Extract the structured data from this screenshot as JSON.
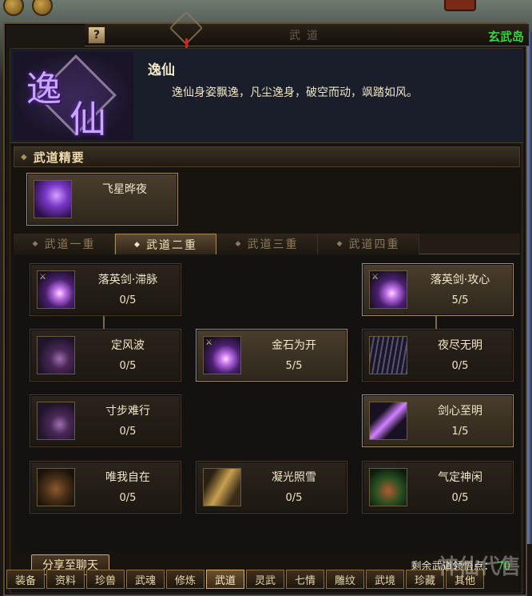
{
  "window": {
    "title": "武道",
    "region": "玄武岛",
    "help_label": "?"
  },
  "header": {
    "emblem_char_1": "逸",
    "emblem_char_2": "仙",
    "class_name": "逸仙",
    "class_desc": "逸仙身姿飘逸，凡尘逸身，破空而动，飒踏如风。"
  },
  "essence": {
    "section_label": "武道精要",
    "card": {
      "name": "飞星晔夜",
      "icon": "ninja-icon"
    }
  },
  "tabs": [
    {
      "label": "武道一重",
      "active": false
    },
    {
      "label": "武道二重",
      "active": true
    },
    {
      "label": "武道三重",
      "active": false
    },
    {
      "label": "武道四重",
      "active": false
    }
  ],
  "skills": {
    "c1r1": {
      "name": "落英剑·滞脉",
      "level": "0/5",
      "icon": "purple-blade-icon"
    },
    "c1r2": {
      "name": "定风波",
      "level": "0/5",
      "icon": "dark-blade-icon"
    },
    "c1r3": {
      "name": "寸步难行",
      "level": "0/5",
      "icon": "dark-blade-icon"
    },
    "c1r4": {
      "name": "唯我自在",
      "level": "0/5",
      "icon": "monk-icon"
    },
    "c2r2": {
      "name": "金石为开",
      "level": "5/5",
      "icon": "purple-blade-icon"
    },
    "c2r4": {
      "name": "凝光照雪",
      "level": "0/5",
      "icon": "gold-icon"
    },
    "c3r1": {
      "name": "落英剑·攻心",
      "level": "5/5",
      "icon": "purple-blade-icon"
    },
    "c3r2": {
      "name": "夜尽无明",
      "level": "0/5",
      "icon": "rays-icon"
    },
    "c3r3": {
      "name": "剑心至明",
      "level": "1/5",
      "icon": "slash-icon"
    },
    "c3r4": {
      "name": "气定神闲",
      "level": "0/5",
      "icon": "green-icon"
    }
  },
  "footer": {
    "share_label": "分享至聊天",
    "points_label": "剩余武道领悟点：",
    "points_value": "70"
  },
  "bottom_tabs": [
    {
      "label": "装备"
    },
    {
      "label": "资料"
    },
    {
      "label": "珍兽"
    },
    {
      "label": "武魂"
    },
    {
      "label": "修炼"
    },
    {
      "label": "武道"
    },
    {
      "label": "灵武"
    },
    {
      "label": "七情"
    },
    {
      "label": "雕纹"
    },
    {
      "label": "武境"
    },
    {
      "label": "珍藏"
    },
    {
      "label": "其他"
    }
  ],
  "watermark": "神仙代售"
}
